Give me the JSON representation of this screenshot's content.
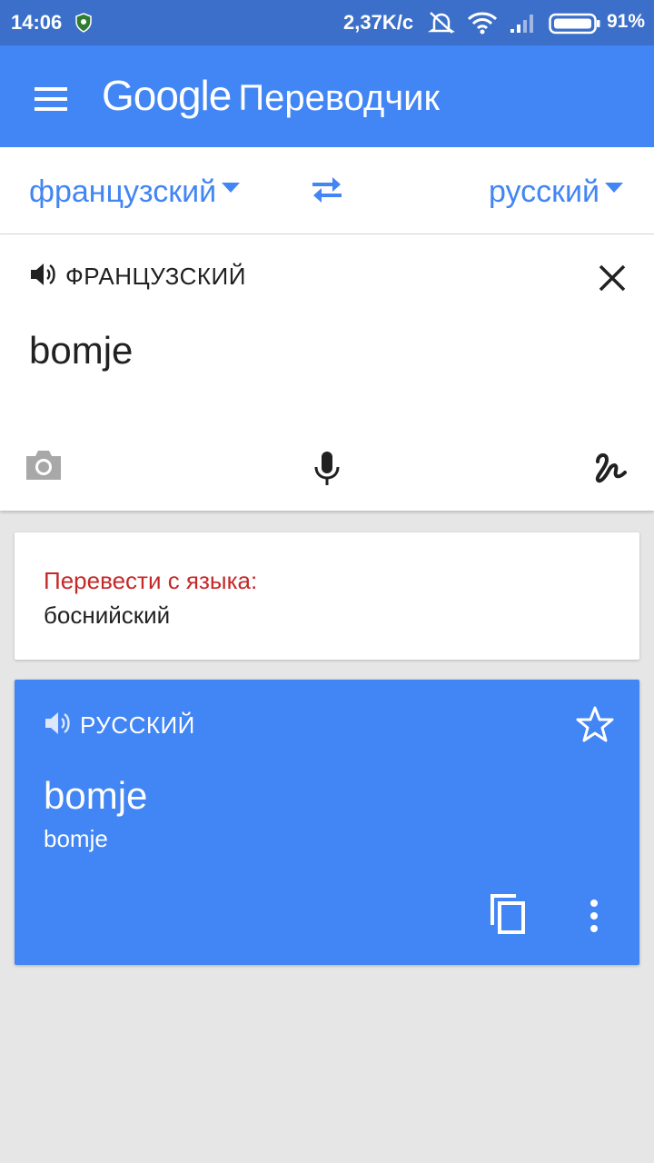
{
  "status_bar": {
    "time": "14:06",
    "speed": "2,37K/c",
    "battery": "91%",
    "icons": [
      "shield-icon",
      "silent-icon",
      "wifi-icon",
      "signal-icon",
      "battery-icon"
    ]
  },
  "app_bar": {
    "brand": "Google",
    "title": "Переводчик",
    "menu_icon": "hamburger-menu-icon"
  },
  "language_bar": {
    "source": "французский",
    "target": "русский",
    "swap_icon": "swap-arrows-icon"
  },
  "input": {
    "language_label": "ФРАНЦУЗСКИЙ",
    "text": "bomje",
    "tools": [
      "camera-icon",
      "microphone-icon",
      "handwriting-icon"
    ]
  },
  "suggestion": {
    "title": "Перевести с языка:",
    "language": "боснийский"
  },
  "result": {
    "language_label": "РУССКИЙ",
    "translation": "bomje",
    "transliteration": "bomje"
  },
  "colors": {
    "status_bar": "#3b6fc9",
    "accent": "#4285f4",
    "warning_text": "#c62828",
    "background": "#e6e6e6"
  }
}
